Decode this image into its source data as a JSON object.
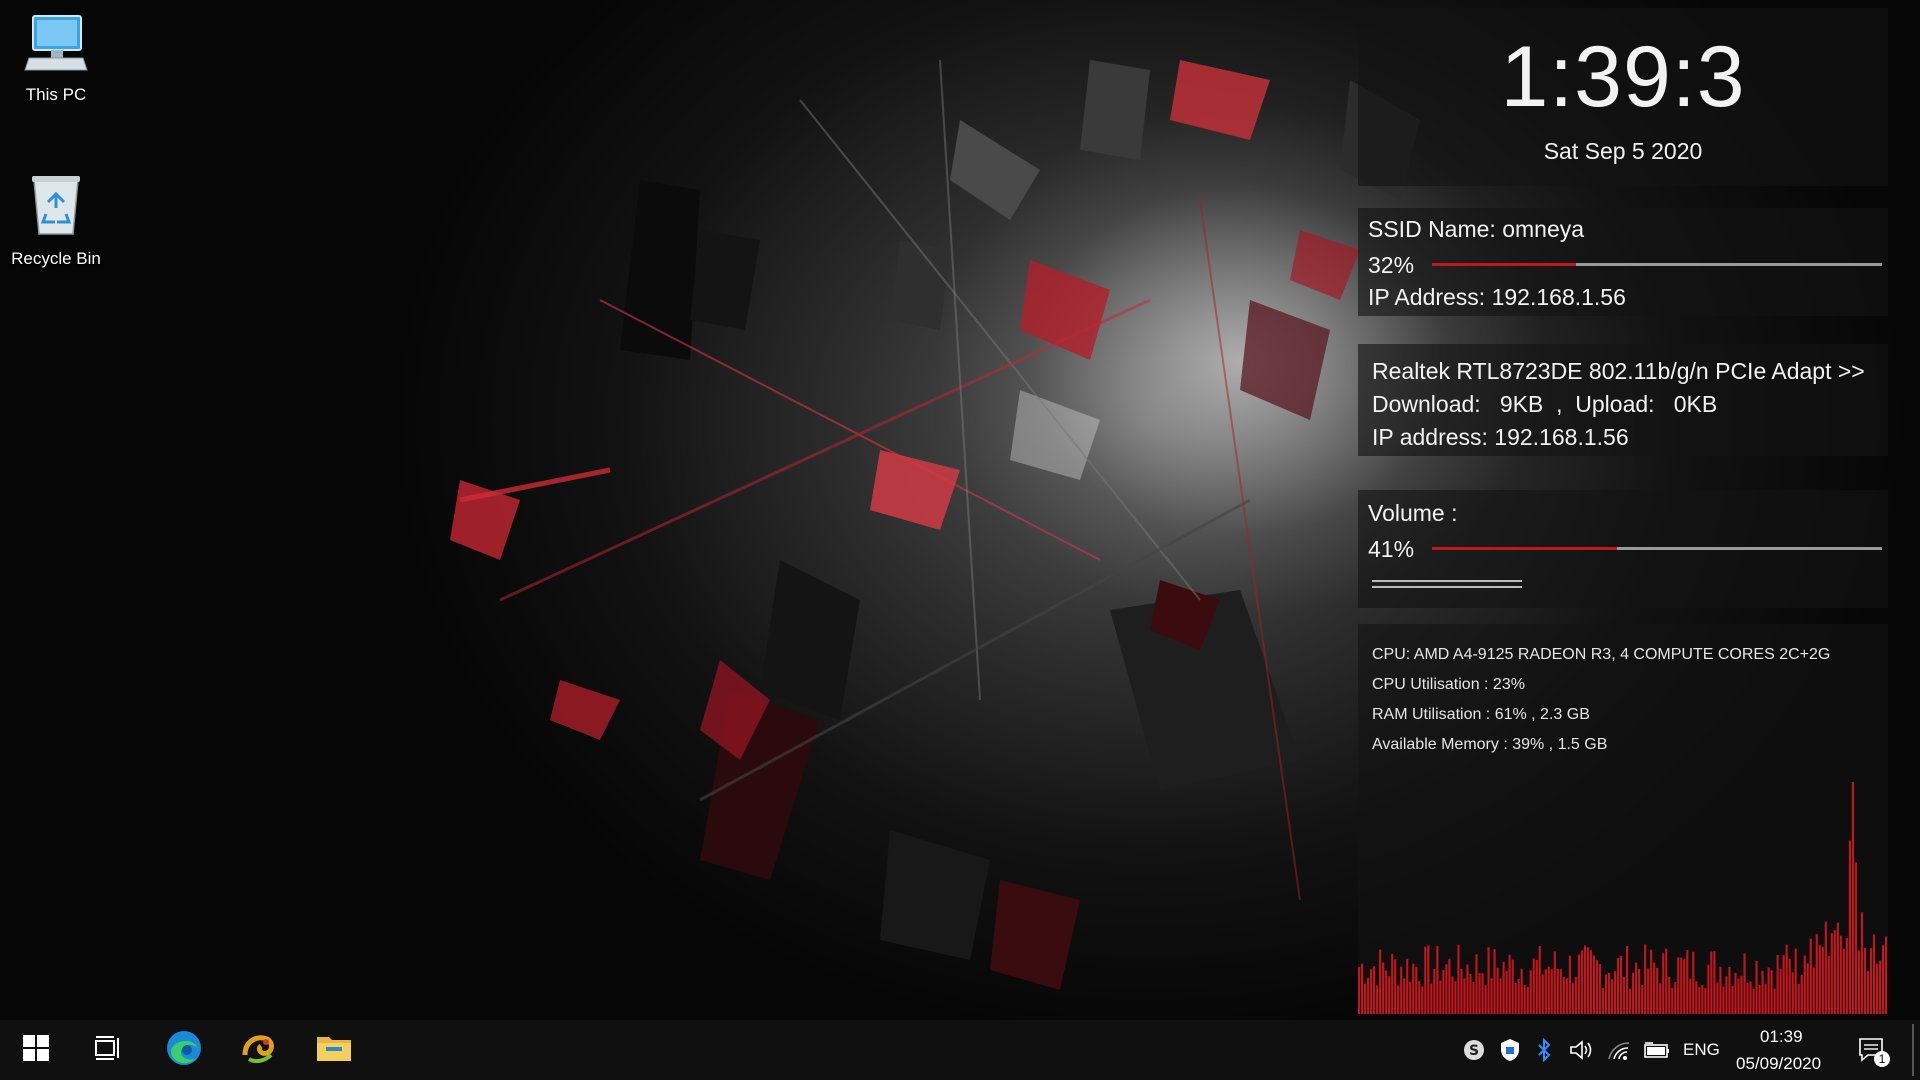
{
  "desktop": {
    "icons": [
      {
        "label": "This PC",
        "icon": "computer-icon"
      },
      {
        "label": "Recycle Bin",
        "icon": "recycle-bin-icon"
      }
    ]
  },
  "widget": {
    "clock": {
      "time": "1:39:3",
      "date": "Sat Sep 5 2020"
    },
    "wifi": {
      "ssid_label": "SSID Name: omneya",
      "signal_text": "32%",
      "signal_value": 32,
      "ip_text": "IP Address: 192.168.1.56"
    },
    "adapter": {
      "name": "Realtek RTL8723DE 802.11b/g/n PCIe Adapt >>",
      "traffic": "Download:   9KB  ,  Upload:   0KB",
      "ip_text": "IP address: 192.168.1.56"
    },
    "volume": {
      "label": "Volume :",
      "level_text": "41%",
      "level_value": 41
    },
    "system": {
      "cpu_name": "CPU: AMD A4-9125 RADEON R3, 4 COMPUTE CORES 2C+2G",
      "cpu_util": "CPU Utilisation : 23%",
      "ram_util": "RAM Utilisation : 61% , 2.3 GB",
      "avail_mem": "Available Memory : 39% , 1.5 GB"
    },
    "accent_color": "#c4161c"
  },
  "taskbar": {
    "start_icon": "windows-start-icon",
    "pinned": [
      "task-view-icon",
      "edge-icon",
      "chameleon-app-icon",
      "file-explorer-icon"
    ],
    "tray": {
      "icons": [
        "skype-icon",
        "security-shield-icon",
        "bluetooth-icon",
        "volume-icon",
        "wifi-icon",
        "battery-icon"
      ],
      "language": "ENG",
      "time": "01:39",
      "date": "05/09/2020",
      "notification_count": "1"
    }
  }
}
